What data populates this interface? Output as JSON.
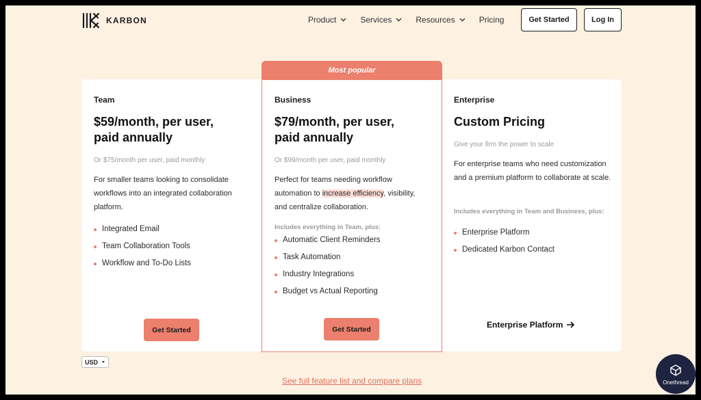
{
  "header": {
    "logo_text": "KARBON",
    "nav": [
      {
        "label": "Product",
        "has_dropdown": true
      },
      {
        "label": "Services",
        "has_dropdown": true
      },
      {
        "label": "Resources",
        "has_dropdown": true
      },
      {
        "label": "Pricing",
        "has_dropdown": false
      }
    ],
    "get_started_label": "Get Started",
    "login_label": "Log In"
  },
  "popular_label": "Most popular",
  "plans": {
    "team": {
      "name": "Team",
      "price": "$59/month, per user, paid annually",
      "sub": "Or $75/month per user, paid monthly",
      "description": "For smaller teams looking to consolidate workflows into an integrated collaboration platform.",
      "features": [
        "Integrated Email",
        "Team Collaboration Tools",
        "Workflow and To-Do Lists"
      ],
      "cta": "Get Started"
    },
    "business": {
      "name": "Business",
      "price": "$79/month, per user, paid annually",
      "sub": "Or $99/month per user, paid monthly",
      "description_before": "Perfect for teams needing workflow automation to ",
      "description_highlight": "increase efficiency",
      "description_after": ", visibility, and centralize collaboration.",
      "includes": "Includes everything in Team, plus:",
      "features": [
        "Automatic Client Reminders",
        "Task Automation",
        "Industry Integrations",
        "Budget vs Actual Reporting"
      ],
      "cta": "Get Started"
    },
    "enterprise": {
      "name": "Enterprise",
      "price": "Custom Pricing",
      "sub": "Give your firm the power to scale",
      "description": "For enterprise teams who need customization and a premium platform to collaborate at scale.",
      "includes": "Includes everything in Team and Business, plus:",
      "features": [
        "Enterprise Platform",
        "Dedicated Karbon Contact"
      ],
      "cta": "Enterprise Platform"
    }
  },
  "currency": "USD",
  "compare_link": "See full feature list and compare plans",
  "watermark": "Onethread",
  "colors": {
    "accent": "#ec7f6d",
    "background": "#fdf1e2",
    "badge": "#1e2340"
  }
}
